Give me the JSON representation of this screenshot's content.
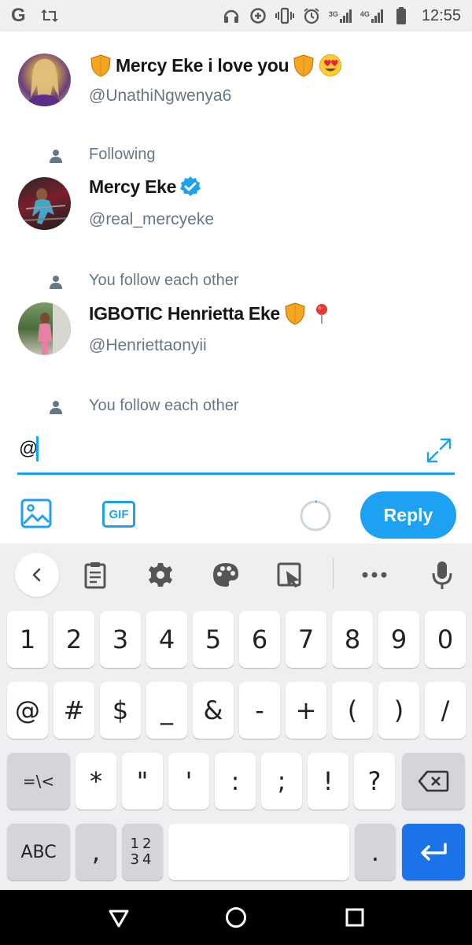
{
  "status_bar": {
    "app_letter": "G",
    "network_labels": [
      "3G",
      "4G"
    ],
    "time": "12:55"
  },
  "suggestions": [
    {
      "name": "Mercy Eke i love you",
      "handle": "@UnathiNgwenya6",
      "context": "",
      "icons": [
        "shield-emoji",
        "shield-emoji",
        "heart-eyes-emoji"
      ],
      "verified": false
    },
    {
      "name": "Mercy Eke",
      "handle": "@real_mercyeke",
      "context": "Following",
      "icons": [
        "verified-badge"
      ],
      "verified": true
    },
    {
      "name": "IGBOTIC Henrietta Eke",
      "handle": "@Henriettaonyii",
      "context": "You follow each other",
      "icons": [
        "shield-emoji",
        "pin-emoji"
      ],
      "verified": false
    },
    {
      "name": "",
      "handle": "",
      "context": "You follow each other",
      "icons": [],
      "verified": false
    }
  ],
  "compose": {
    "text": "@",
    "gif_label": "GIF",
    "reply_label": "Reply"
  },
  "keyboard": {
    "toolbar": [
      "back",
      "clipboard",
      "settings",
      "theme",
      "select",
      "more",
      "voice"
    ],
    "row1": [
      "1",
      "2",
      "3",
      "4",
      "5",
      "6",
      "7",
      "8",
      "9",
      "0"
    ],
    "row2": [
      "@",
      "#",
      "$",
      "_",
      "&",
      "-",
      "+",
      "(",
      ")",
      "/"
    ],
    "row3": [
      "=\\<",
      "*",
      "\"",
      "'",
      ":",
      ";",
      "!",
      "?"
    ],
    "row4": {
      "abc": "ABC",
      "comma": ",",
      "numpad_top": "12",
      "numpad_bottom": "34",
      "period": "."
    }
  },
  "colors": {
    "accent": "#1da1f2",
    "enter_key": "#1a73e8",
    "secondary_text": "#657786"
  }
}
